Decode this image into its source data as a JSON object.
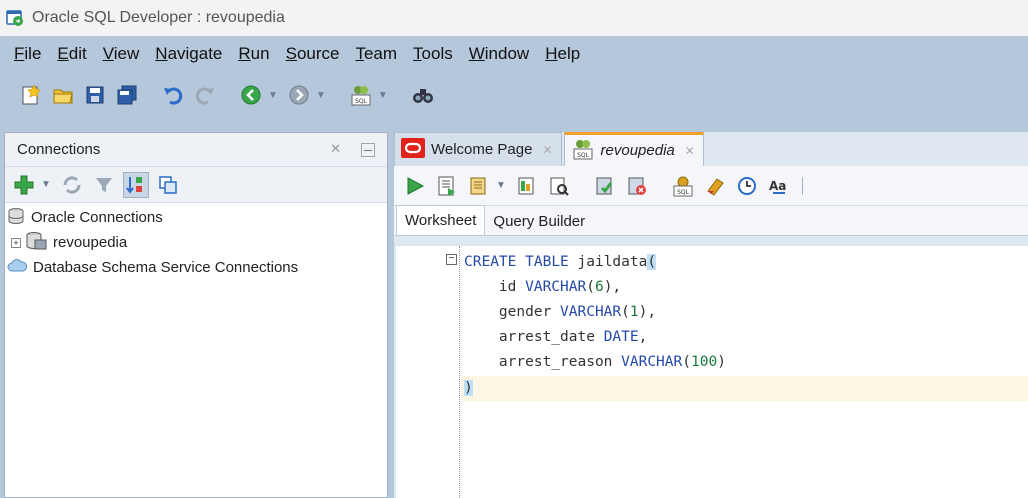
{
  "window": {
    "title": "Oracle SQL Developer : revoupedia"
  },
  "menubar": {
    "items": [
      "File",
      "Edit",
      "View",
      "Navigate",
      "Run",
      "Source",
      "Team",
      "Tools",
      "Window",
      "Help"
    ]
  },
  "connections_panel": {
    "title": "Connections",
    "tree": [
      {
        "label": "Oracle Connections"
      },
      {
        "label": "revoupedia"
      },
      {
        "label": "Database Schema Service Connections"
      }
    ]
  },
  "doc_tabs": {
    "welcome": "Welcome Page",
    "worksheet": "revoupedia"
  },
  "sub_tabs": {
    "worksheet": "Worksheet",
    "query_builder": "Query Builder"
  },
  "editor": {
    "line1": {
      "kw1": "CREATE",
      "kw2": "TABLE",
      "name": " jaildata",
      "paren": "("
    },
    "line2": {
      "col": "    id ",
      "type": "VARCHAR",
      "open": "(",
      "num": "6",
      "close": "),"
    },
    "line3": {
      "col": "    gender ",
      "type": "VARCHAR",
      "open": "(",
      "num": "1",
      "close": "),"
    },
    "line4": {
      "col": "    arrest_date ",
      "type": "DATE",
      "close": ","
    },
    "line5": {
      "col": "    arrest_reason ",
      "type": "VARCHAR",
      "open": "(",
      "num": "100",
      "close": ")"
    },
    "line6": {
      "paren": ")"
    }
  },
  "colors": {
    "keyword": "#2449a8",
    "number": "#1b7a3c",
    "active_tab_accent": "#f0a030"
  }
}
